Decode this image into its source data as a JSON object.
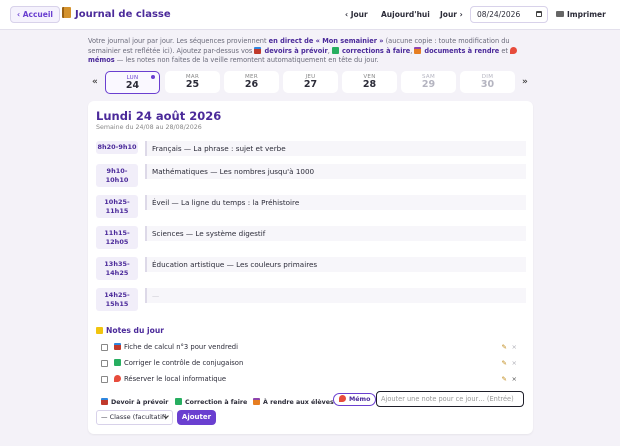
{
  "topbar": {
    "back_label": "‹ Accueil",
    "title": "Journal de classe",
    "prev_day": "‹ Jour",
    "today": "Aujourd'hui",
    "next_day": "Jour ›",
    "date_value": "08/24/2026",
    "print": "Imprimer"
  },
  "intro": {
    "part1": "Votre journal jour par jour. Les séquences proviennent ",
    "bold1": "en direct de « Mon semainier »",
    "part2": " (aucune copie : toute modification du semainier est reflétée ici). Ajoutez par-dessus vos ",
    "bold2": "devoirs à prévoir",
    "part3": ", ",
    "bold3": "corrections à faire",
    "part4": ", ",
    "bold4": "documents à rendre",
    "part5": " et ",
    "bold5": "mémos",
    "part6": " — les notes non faites de la veille remontent automatiquement en tête du jour."
  },
  "day_nav": {
    "prev": "«",
    "next": "»",
    "days": [
      {
        "name": "LUN",
        "num": "24"
      },
      {
        "name": "MAR",
        "num": "25"
      },
      {
        "name": "MER",
        "num": "26"
      },
      {
        "name": "JEU",
        "num": "27"
      },
      {
        "name": "VEN",
        "num": "28"
      },
      {
        "name": "SAM",
        "num": "29"
      },
      {
        "name": "DIM",
        "num": "30"
      }
    ]
  },
  "day": {
    "title": "Lundi 24 août 2026",
    "week": "Semaine du 24/08 au 28/08/2026"
  },
  "slots": [
    {
      "time": "8h20-9h10",
      "lesson": "Français — La phrase : sujet et verbe"
    },
    {
      "time": "9h10-10h10",
      "lesson": "Mathématiques — Les nombres jusqu'à 1000"
    },
    {
      "time": "10h25-11h15",
      "lesson": "Éveil — La ligne du temps : la Préhistoire"
    },
    {
      "time": "11h15-12h05",
      "lesson": "Sciences — Le système digestif"
    },
    {
      "time": "13h35-14h25",
      "lesson": "Éducation artistique — Les couleurs primaires"
    },
    {
      "time": "14h25-15h15",
      "lesson": "—"
    }
  ],
  "notes": {
    "title": "Notes du jour",
    "items": [
      {
        "text": "Fiche de calcul n°3 pour vendredi",
        "edit": "✎",
        "delete": "×"
      },
      {
        "text": "Corriger le contrôle de conjugaison",
        "edit": "✎",
        "delete": "×"
      },
      {
        "text": "Réserver le local informatique",
        "edit": "✎",
        "delete": "×"
      }
    ],
    "tags": {
      "devoir": "Devoir à prévoir",
      "correction": "Correction à faire",
      "rendre": "À rendre aux élèves",
      "memo": "Mémo"
    },
    "input_placeholder": "Ajouter une note pour ce jour… (Entrée)",
    "class_select": "— Classe (facultatif)",
    "add": "Ajouter"
  },
  "colors": {
    "accent": "#6a3fd0",
    "title": "#4b2a9a"
  }
}
